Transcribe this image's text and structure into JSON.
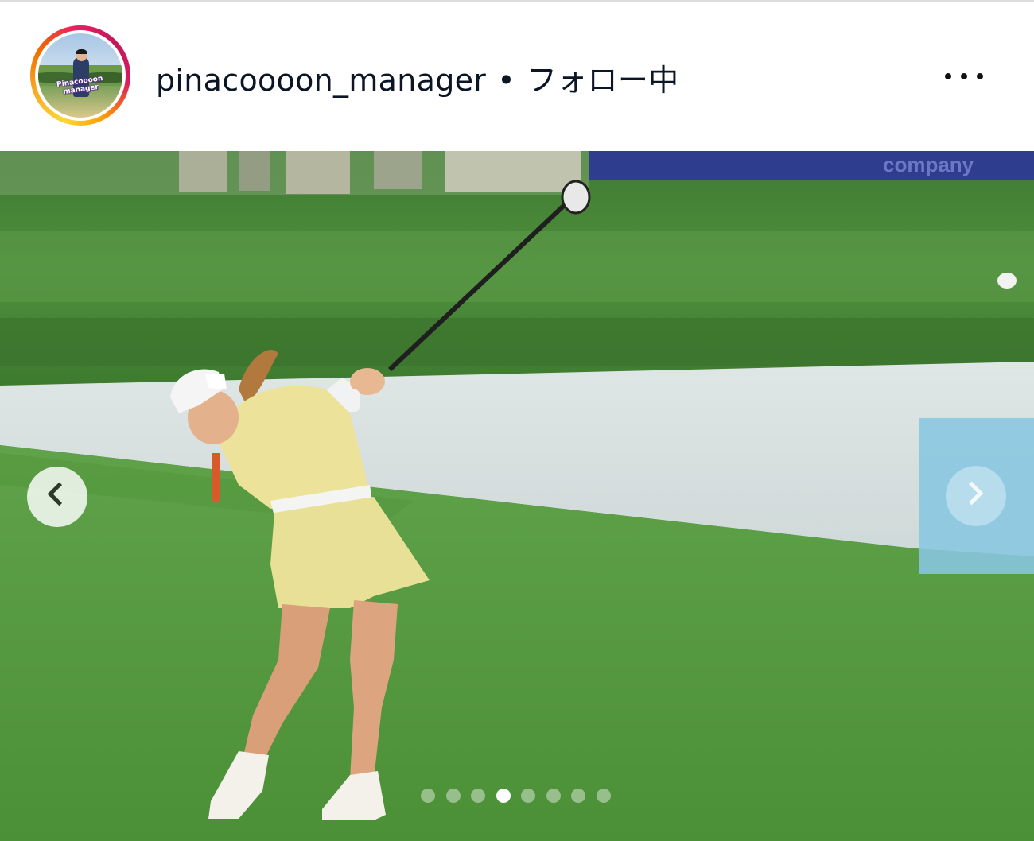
{
  "header": {
    "username": "pinacoooon_manager",
    "separator": "•",
    "follow_status": "フォロー中",
    "more_label": "More options",
    "avatar_text": "Pinacoooon manager"
  },
  "carousel": {
    "prev_label": "Previous",
    "next_label": "Next",
    "total_slides": 8,
    "active_slide": 4
  },
  "photo": {
    "description_icon": "golfer-photo",
    "background_banner_text": "company"
  },
  "colors": {
    "text": "#0b1524",
    "story_ring": [
      "#fdd835",
      "#ef6c00",
      "#e91e63"
    ],
    "next_hover": "#87c6e0"
  }
}
